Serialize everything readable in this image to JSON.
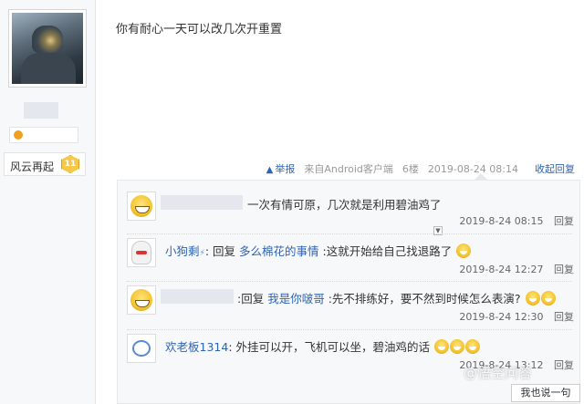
{
  "profile": {
    "username": "风云再起",
    "level": "11"
  },
  "post": {
    "text": "你有耐心一天可以改几次开重置",
    "report_label": "举报",
    "source": "来自Android客户端",
    "floor": "6楼",
    "time": "2019-08-24 08:14",
    "collapse_label": "收起回复"
  },
  "replies": [
    {
      "text": "一次有情可原，几次就是利用碧油鸡了",
      "time": "2019-8-24 08:15",
      "reply_label": "回复"
    },
    {
      "username": "小狗剩",
      "reply_word": "回复",
      "target": "多么棉花的事情",
      "text": ":这就开始给自己找退路了",
      "time": "2019-8-24 12:27",
      "reply_label": "回复"
    },
    {
      "reply_word": "回复",
      "target": "我是你啵哥",
      "text": ":先不排练好，要不然到时候怎么表演?",
      "time": "2019-8-24 12:30",
      "reply_label": "回复"
    },
    {
      "username": "欢老板1314",
      "text": "外挂可以开，飞机可以坐，碧油鸡的话",
      "time": "2019-8-24 13:12",
      "reply_label": "回复"
    }
  ],
  "footer": {
    "reply_button": "我也说一句",
    "watermark": "@悟空问答"
  }
}
